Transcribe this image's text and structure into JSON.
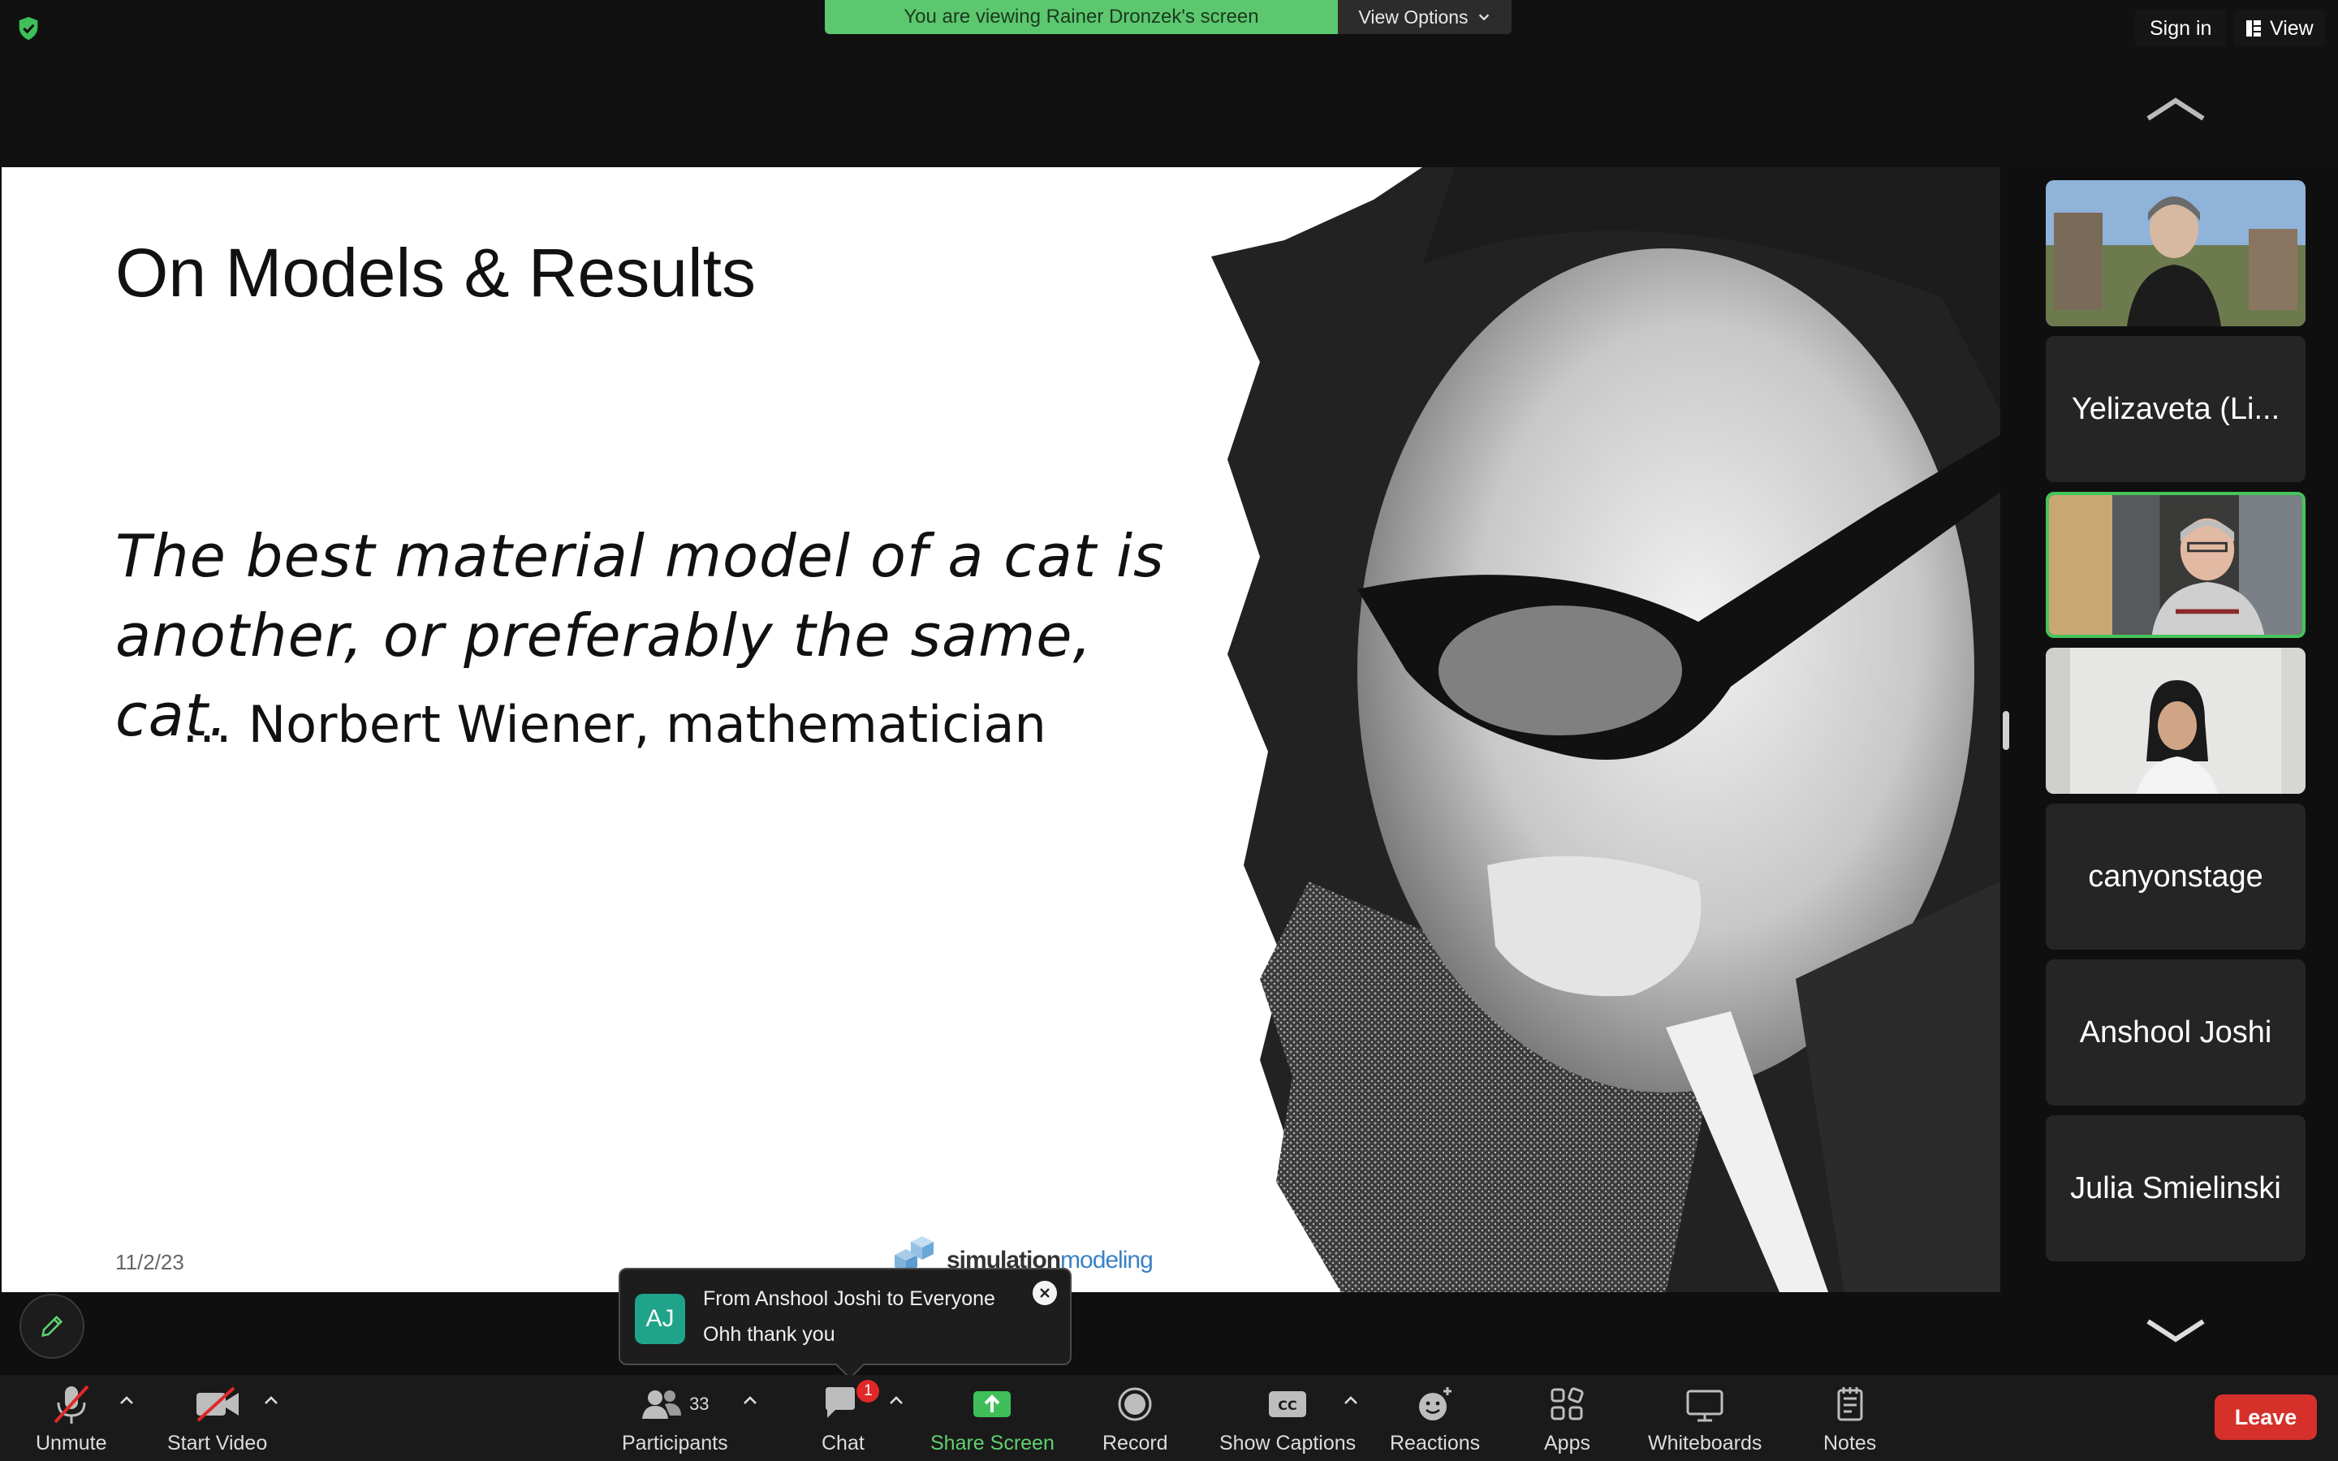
{
  "top_bar": {
    "viewing_banner": "You are viewing Rainer Dronzek's screen",
    "view_options": "View Options",
    "sign_in": "Sign in",
    "view": "View"
  },
  "slide": {
    "title": "On Models & Results",
    "quote_line1": "The best material model of a cat is",
    "quote_line2": "another, or preferably the same, cat.",
    "attribution": "… Norbert Wiener, mathematician",
    "date": "11/2/23",
    "logo_text_a": "simulation",
    "logo_text_b": "modeling"
  },
  "participants": [
    {
      "type": "video",
      "description_icon": "person-outdoors"
    },
    {
      "type": "name",
      "name": "Yelizaveta (Li..."
    },
    {
      "type": "video",
      "description_icon": "person-headset",
      "active_speaker": true
    },
    {
      "type": "video",
      "description_icon": "person-indoors"
    },
    {
      "type": "name",
      "name": "canyonstage"
    },
    {
      "type": "name",
      "name": "Anshool Joshi"
    },
    {
      "type": "name",
      "name": "Julia Smielinski"
    }
  ],
  "chat_toast": {
    "avatar_initials": "AJ",
    "from": "From Anshool Joshi to Everyone",
    "message": "Ohh thank you"
  },
  "toolbar": {
    "unmute": "Unmute",
    "start_video": "Start Video",
    "participants": "Participants",
    "participants_count": "33",
    "chat": "Chat",
    "chat_badge": "1",
    "share_screen": "Share Screen",
    "record": "Record",
    "show_captions": "Show Captions",
    "reactions": "Reactions",
    "apps": "Apps",
    "whiteboards": "Whiteboards",
    "notes": "Notes",
    "leave": "Leave"
  },
  "colors": {
    "banner_green": "#5cc76e",
    "active_border": "#46c45a",
    "leave_red": "#d5302a",
    "badge_red": "#e02828",
    "avatar_teal": "#1fa38a"
  }
}
